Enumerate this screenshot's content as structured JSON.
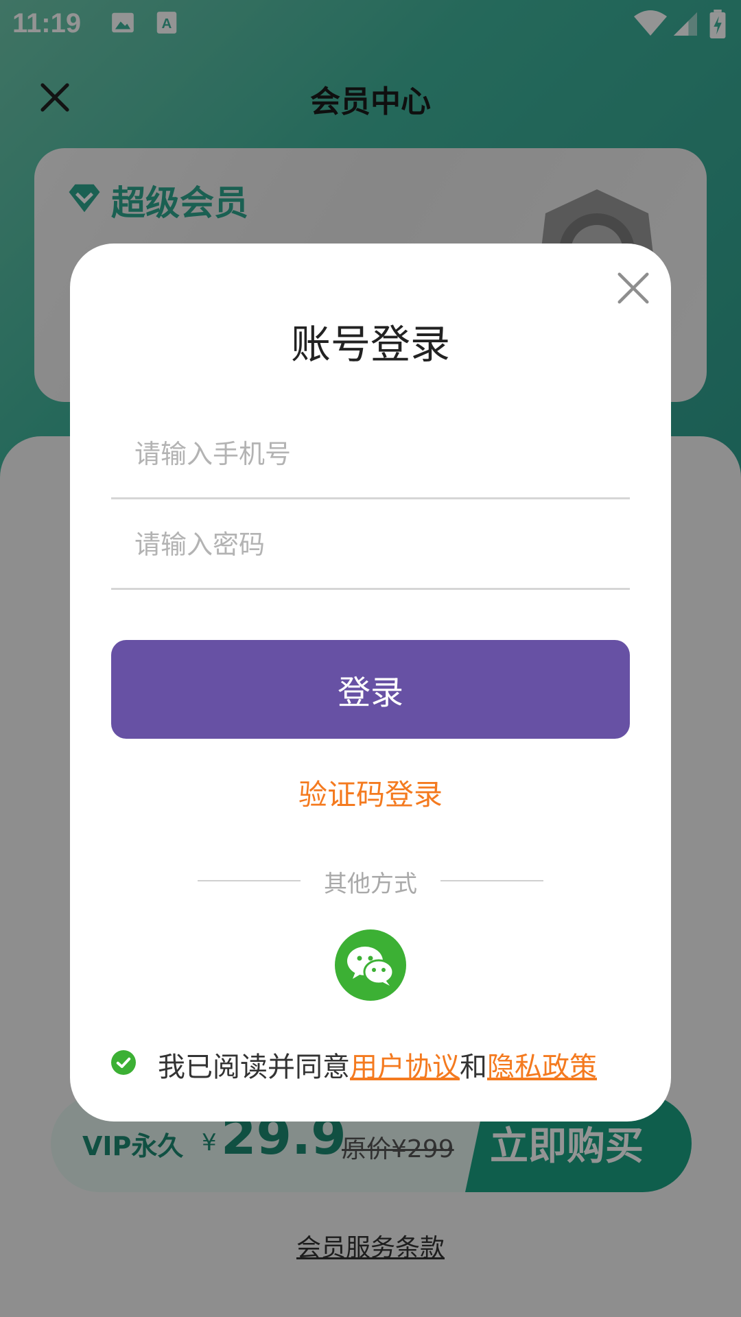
{
  "status_bar": {
    "time": "11:19"
  },
  "page": {
    "title": "会员中心",
    "card_badge": "超级会员",
    "buy_bar": {
      "plan": "VIP永久",
      "currency": "¥",
      "price": "29.9",
      "original_price": "原价¥299",
      "buy_label": "立即购买"
    },
    "terms_link": "会员服务条款"
  },
  "modal": {
    "title": "账号登录",
    "phone_placeholder": "请输入手机号",
    "password_placeholder": "请输入密码",
    "login_button": "登录",
    "code_login_link": "验证码登录",
    "other_methods": "其他方式",
    "agreement": {
      "prefix": "我已阅读并同意",
      "user_agreement": "用户协议",
      "and": "和",
      "privacy_policy": "隐私政策",
      "checked": true
    }
  },
  "colors": {
    "primary_button": "#6751a4",
    "link_orange": "#f47a1f",
    "wechat_green": "#3cb034",
    "teal": "#1aa384"
  },
  "icons": [
    "close-icon",
    "image-icon",
    "text-a-icon",
    "wifi-icon",
    "signal-icon",
    "battery-icon",
    "diamond-icon",
    "wechat-icon",
    "check-circle-icon"
  ]
}
